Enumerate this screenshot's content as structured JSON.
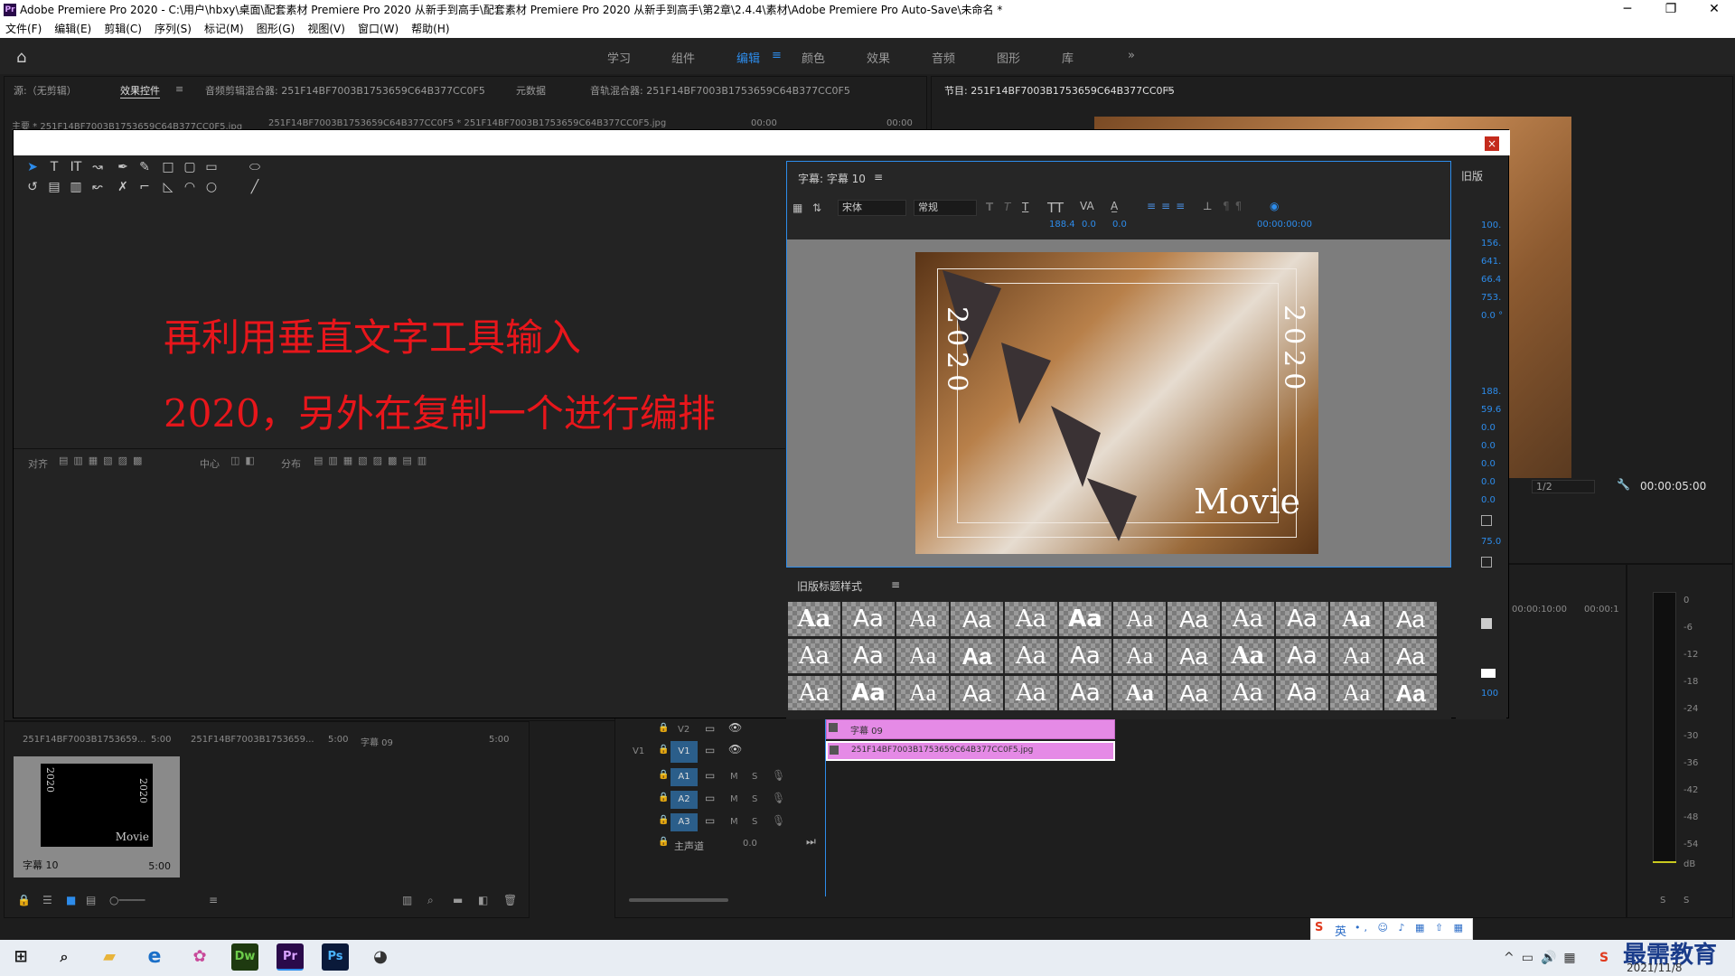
{
  "window": {
    "title": "Adobe Premiere Pro 2020 - C:\\用户\\hbxy\\桌面\\配套素材 Premiere Pro 2020 从新手到高手\\配套素材 Premiere Pro 2020 从新手到高手\\第2章\\2.4.4\\素材\\Adobe Premiere Pro Auto-Save\\未命名 *",
    "logo": "Pr",
    "minimize": "─",
    "restore": "❐",
    "close": "✕"
  },
  "menu": [
    "文件(F)",
    "编辑(E)",
    "剪辑(C)",
    "序列(S)",
    "标记(M)",
    "图形(G)",
    "视图(V)",
    "窗口(W)",
    "帮助(H)"
  ],
  "workspaces": {
    "items": [
      "学习",
      "组件",
      "编辑",
      "颜色",
      "效果",
      "音频",
      "图形",
      "库"
    ],
    "active_index": 2,
    "more": "»",
    "menu_icon": "≡"
  },
  "source_panel": {
    "tabs": [
      "源:（无剪辑）",
      "效果控件",
      "音频剪辑混合器: 251F14BF7003B1753659C64B377CC0F5",
      "元数据",
      "音轨混合器: 251F14BF7003B1753659C64B377CC0F5"
    ],
    "active_tab": 1,
    "menu_icon": "≡",
    "clip_line": "主要 * 251F14BF7003B1753659C64B377CC0F5.jpg",
    "clip_link": "251F14BF7003B1753659C64B377CC0F5 * 251F14BF7003B1753659C64B377CC0F5.jpg",
    "time_start": "00:00",
    "time_end": "00:00"
  },
  "program_panel": {
    "title": "节目: 251F14BF7003B1753659C64B377CC0F5",
    "menu_icon": "≡",
    "zoom": "1/2",
    "timecode": "00:00:05:00"
  },
  "titler": {
    "close_label": "×",
    "instruction_line1": "再利用垂直文字工具输入",
    "instruction_line2": "2020，另外在复制一个进行编排",
    "align_label": "对齐",
    "center_label": "中心",
    "distribute_label": "分布",
    "title_panel": "字幕: 字幕 10",
    "font_family": "宋体",
    "font_style": "常规",
    "font_size": "188.4",
    "kerning": "0.0",
    "leading": "0.0",
    "timecode": "00:00:00:00",
    "canvas_text_left": "2020",
    "canvas_text_right": "2020",
    "canvas_text_movie": "Movie",
    "props_title": "旧版",
    "props_values": [
      "100.",
      "156.",
      "641.",
      "66.4",
      "753.",
      "0.0 °",
      "188.",
      "59.6",
      "0.0",
      "0.0",
      "0.0",
      "0.0",
      "0.0",
      "75.0",
      "100"
    ],
    "styles_title": "旧版标题样式",
    "style_sample": "Aa"
  },
  "project_panel": {
    "items": [
      {
        "name": "251F14BF7003B1753659...",
        "dur": "5:00"
      },
      {
        "name": "251F14BF7003B1753659...",
        "dur": "5:00"
      },
      {
        "name": "字幕 09",
        "dur": "5:00"
      }
    ],
    "selected": {
      "name": "字幕 10",
      "dur": "5:00",
      "thumb_left": "2020",
      "thumb_right": "2020",
      "thumb_movie": "Movie"
    }
  },
  "timeline": {
    "ruler": [
      "00:00:10:00",
      "00:00:1"
    ],
    "tracks": [
      {
        "name": "V2",
        "type": "video"
      },
      {
        "name": "V1",
        "type": "video",
        "src": "V1"
      },
      {
        "name": "A1",
        "type": "audio"
      },
      {
        "name": "A2",
        "type": "audio"
      },
      {
        "name": "A3",
        "type": "audio"
      }
    ],
    "master_label": "主声道",
    "master_value": "0.0",
    "clip_v2": "字幕 09",
    "clip_v1": "251F14BF7003B1753659C64B377CC0F5.jpg",
    "m": "M",
    "s": "S"
  },
  "meter": {
    "scale": [
      "0",
      "-6",
      "-12",
      "-18",
      "-24",
      "-30",
      "-36",
      "-42",
      "-48",
      "-54",
      "dB"
    ],
    "s1": "S",
    "s2": "S"
  },
  "ime": {
    "label": "英",
    "items": [
      "•,",
      "☺",
      "🎤",
      "⌨",
      "♪",
      "👕",
      "▦"
    ]
  },
  "taskbar": {
    "apps": [
      "Dw",
      "Pr",
      "Ps"
    ],
    "brand": "最需教育",
    "date": "2021/11/8"
  },
  "colors": {
    "accent": "#2d8ceb",
    "instruction_red": "#e8161b",
    "clip_pink": "#e58ae6",
    "track_blue": "#2b5e8a"
  }
}
